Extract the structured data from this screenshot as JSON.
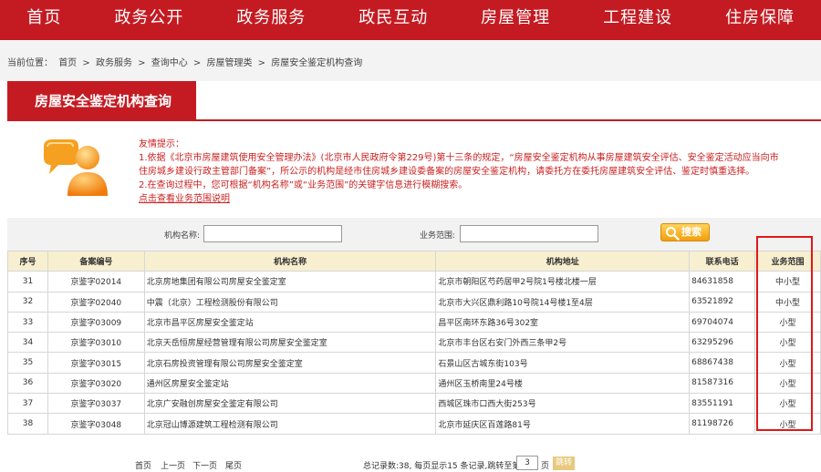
{
  "nav": {
    "items": [
      "首页",
      "政务公开",
      "政务服务",
      "政民互动",
      "房屋管理",
      "工程建设",
      "住房保障"
    ]
  },
  "breadcrumb": {
    "label": "当前位置：",
    "items": [
      "首页",
      ">",
      "政务服务",
      ">",
      "查询中心",
      ">",
      "房屋管理类",
      ">",
      "房屋安全鉴定机构查询"
    ]
  },
  "panel": {
    "title": "房屋安全鉴定机构查询"
  },
  "notice": {
    "heading": "友情提示：",
    "line1": "1.依据《北京市房屋建筑使用安全管理办法》(北京市人民政府令第229号)第十三条的规定，“房屋安全鉴定机构从事房屋建筑安全评估、安全鉴定活动应当向市",
    "line2": "住房城乡建设行政主管部门备案”，所公示的机构是经市住房城乡建设委备案的房屋安全鉴定机构，请委托方在委托房屋建筑安全评估、鉴定时慎重选择。",
    "line3": "2.在查询过程中，您可根据“机构名称”或“业务范围”的关键字信息进行模糊搜索。",
    "link": "点击查看业务范围说明"
  },
  "search": {
    "name_label": "机构名称:",
    "name_value": "",
    "scope_label": "业务范围:",
    "scope_value": "",
    "button": "搜索"
  },
  "table": {
    "headers": [
      "序号",
      "备案编号",
      "机构名称",
      "机构地址",
      "联系电话",
      "业务范围"
    ],
    "rows": [
      [
        "31",
        "京鉴字02014",
        "北京房地集团有限公司房屋安全鉴定室",
        "北京市朝阳区芍药居甲2号院1号楼北楼一层",
        "84631858",
        "中小型"
      ],
      [
        "32",
        "京鉴字02040",
        "中震（北京）工程检测股份有限公司",
        "北京市大兴区鼎利路10号院14号楼1至4层",
        "63521892",
        "中小型"
      ],
      [
        "33",
        "京鉴字03009",
        "北京市昌平区房屋安全鉴定站",
        "昌平区南环东路36号302室",
        "69704074",
        "小型"
      ],
      [
        "34",
        "京鉴字03010",
        "北京天岳恒房屋经营管理有限公司房屋安全鉴定室",
        "北京市丰台区右安门外西三条甲2号",
        "63295296",
        "小型"
      ],
      [
        "35",
        "京鉴字03015",
        "北京石房投资管理有限公司房屋安全鉴定室",
        "石景山区古城东街103号",
        "68867438",
        "小型"
      ],
      [
        "36",
        "京鉴字03020",
        "通州区房屋安全鉴定站",
        "通州区玉桥南里24号楼",
        "81587316",
        "小型"
      ],
      [
        "37",
        "京鉴字03037",
        "北京广安融创房屋安全鉴定有限公司",
        "西城区珠市口西大街253号",
        "83551191",
        "小型"
      ],
      [
        "38",
        "京鉴字03048",
        "北京冠山博源建筑工程检测有限公司",
        "北京市延庆区百莲路81号",
        "81198726",
        "小型"
      ]
    ]
  },
  "pager": {
    "first": "首页",
    "prev": "上一页",
    "next": "下一页",
    "last": "尾页",
    "summary": "总记录数:38, 每页显示15 条记录,跳转至第",
    "page_value": "3",
    "page_unit": "页",
    "go": "跳转"
  },
  "colors": {
    "brand_red": "#c41b22",
    "header_bg": "#f7efcf",
    "search_button": "#f29e0c",
    "highlight": "#e01818"
  }
}
